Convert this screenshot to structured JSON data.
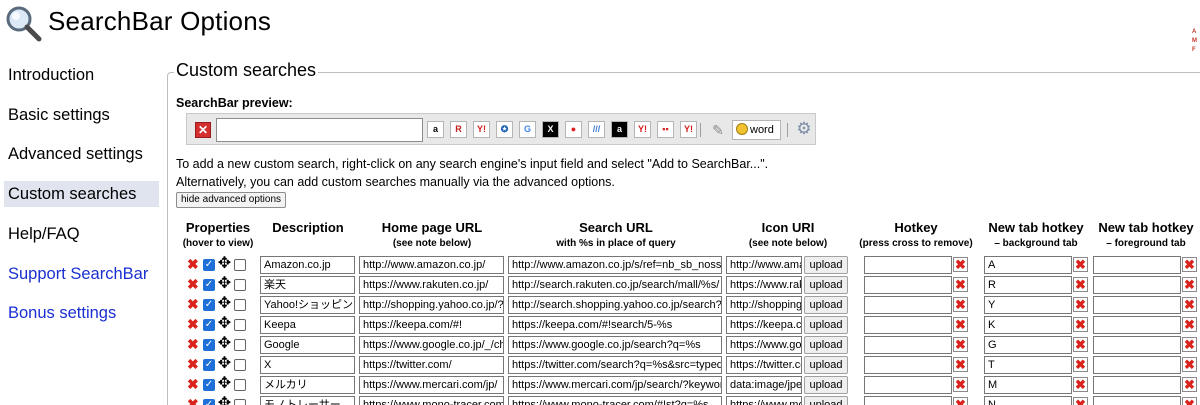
{
  "header": {
    "title": "SearchBar Options",
    "logo_icon": "magnifier-icon"
  },
  "sidebar": {
    "items": [
      {
        "label": "Introduction",
        "type": "item"
      },
      {
        "label": "Basic settings",
        "type": "item"
      },
      {
        "label": "Advanced settings",
        "type": "item"
      },
      {
        "label": "Custom searches",
        "type": "active"
      },
      {
        "label": "Help/FAQ",
        "type": "item"
      },
      {
        "label": "Support SearchBar",
        "type": "link"
      },
      {
        "label": "Bonus settings",
        "type": "link"
      }
    ]
  },
  "main": {
    "section_title": "Custom searches",
    "preview_label": "SearchBar preview:",
    "searchbar": {
      "engines": [
        "a",
        "R",
        "Y!",
        "✪",
        "G",
        "X",
        "●",
        "///",
        "a",
        "Y!",
        "▪▪",
        "Y!"
      ],
      "word_label": "word"
    },
    "instruction_line1": "To add a new custom search, right-click on any search engine's input field and select \"Add to SearchBar...\".",
    "instruction_line2": "Alternatively, you can add custom searches manually via the advanced options.",
    "hide_advanced_label": "hide advanced options"
  },
  "table": {
    "headers": [
      {
        "title": "Properties",
        "sub": "(hover to view)"
      },
      {
        "title": "Description",
        "sub": ""
      },
      {
        "title": "Home page URL",
        "sub": "(see note below)"
      },
      {
        "title": "Search URL",
        "sub": "with %s in place of query"
      },
      {
        "title": "Icon URI",
        "sub": "(see note below)"
      },
      {
        "title": "Hotkey",
        "sub": "(press cross to remove)"
      },
      {
        "title": "New tab hotkey",
        "sub": "– background tab"
      },
      {
        "title": "New tab hotkey",
        "sub": "– foreground tab"
      }
    ],
    "upload_label": "upload",
    "rows": [
      {
        "description": "Amazon.co.jp",
        "home": "http://www.amazon.co.jp/",
        "search": "http://www.amazon.co.jp/s/ref=nb_sb_noss?",
        "icon": "http://www.ama",
        "hotkey": "",
        "bg_hotkey": "A",
        "fg_hotkey": ""
      },
      {
        "description": "楽天",
        "home": "https://www.rakuten.co.jp/",
        "search": "http://search.rakuten.co.jp/search/mall/%s/",
        "icon": "https://www.rak",
        "hotkey": "",
        "bg_hotkey": "R",
        "fg_hotkey": ""
      },
      {
        "description": "Yahoo!ショッピン",
        "home": "http://shopping.yahoo.co.jp/?s",
        "search": "http://search.shopping.yahoo.co.jp/search?t",
        "icon": "http://shopping",
        "hotkey": "",
        "bg_hotkey": "Y",
        "fg_hotkey": ""
      },
      {
        "description": "Keepa",
        "home": "https://keepa.com/#!",
        "search": "https://keepa.com/#!search/5-%s",
        "icon": "https://keepa.c",
        "hotkey": "",
        "bg_hotkey": "K",
        "fg_hotkey": ""
      },
      {
        "description": "Google",
        "home": "https://www.google.co.jp/_/ch",
        "search": "https://www.google.co.jp/search?q=%s",
        "icon": "https://www.goo",
        "hotkey": "",
        "bg_hotkey": "G",
        "fg_hotkey": ""
      },
      {
        "description": "X",
        "home": "https://twitter.com/",
        "search": "https://twitter.com/search?q=%s&src=typed",
        "icon": "https://twitter.cc",
        "hotkey": "",
        "bg_hotkey": "T",
        "fg_hotkey": ""
      },
      {
        "description": "メルカリ",
        "home": "https://www.mercari.com/jp/",
        "search": "https://www.mercari.com/jp/search/?keywor",
        "icon": "data:image/jpe",
        "hotkey": "",
        "bg_hotkey": "M",
        "fg_hotkey": ""
      },
      {
        "description": "モノトレーサー",
        "home": "https://www.mono-tracer.com",
        "search": "https://www.mono-tracer.com/#!st?q=%s",
        "icon": "https://www.mo",
        "hotkey": "",
        "bg_hotkey": "N",
        "fg_hotkey": ""
      }
    ]
  },
  "colors": {
    "active_nav_bg": "#dfe4ee",
    "link": "#1a2fd1",
    "delete_red": "#d9231c",
    "checkbox_blue": "#1f6fd9"
  }
}
